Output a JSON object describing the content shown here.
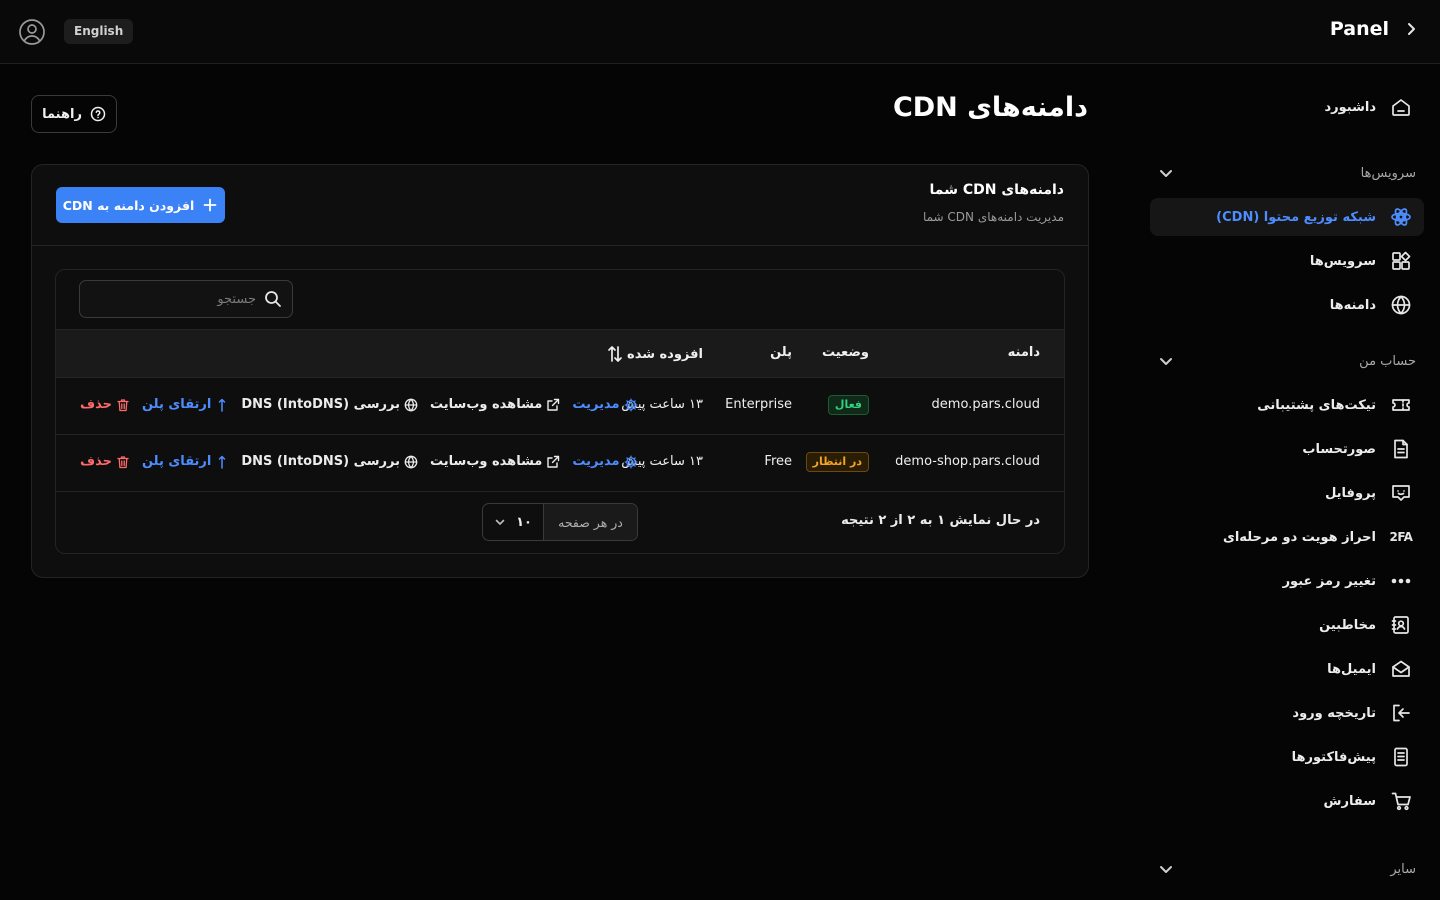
{
  "topbar": {
    "language": "English",
    "brand": "Panel"
  },
  "sidebar": {
    "dashboard": "داشبورد",
    "sections": [
      {
        "label": "سرویس‌ها",
        "items": [
          {
            "label": "شبکه توزیع محتوا (CDN)",
            "icon": "cdn-network-icon",
            "active": true
          },
          {
            "label": "سرویس‌ها",
            "icon": "services-icon"
          },
          {
            "label": "دامنه‌ها",
            "icon": "globe-icon"
          }
        ]
      },
      {
        "label": "حساب من",
        "items": [
          {
            "label": "تیکت‌های پشتیبانی",
            "icon": "ticket-icon"
          },
          {
            "label": "صورتحساب",
            "icon": "invoice-icon"
          },
          {
            "label": "پروفایل",
            "icon": "profile-icon"
          },
          {
            "label": "احراز هویت دو مرحله‌ای",
            "icon": "2fa-icon",
            "icon_text": "2FA"
          },
          {
            "label": "تغییر رمز عبور",
            "icon": "password-icon"
          },
          {
            "label": "مخاطبین",
            "icon": "contacts-icon"
          },
          {
            "label": "ایمیل‌ها",
            "icon": "mail-icon"
          },
          {
            "label": "تاریخچه ورود",
            "icon": "login-history-icon"
          },
          {
            "label": "پیش‌فاکتورها",
            "icon": "proforma-icon"
          },
          {
            "label": "سفارش",
            "icon": "cart-icon"
          }
        ]
      },
      {
        "label": "سایر",
        "items": []
      }
    ]
  },
  "page": {
    "title": "دامنه‌های CDN",
    "guide_button": "راهنما"
  },
  "card": {
    "title": "دامنه‌های CDN شما",
    "subtitle": "مدیریت دامنه‌های CDN شما",
    "add_button": "افزودن دامنه به CDN",
    "search_placeholder": "جستجو",
    "columns": {
      "domain": "دامنه",
      "status": "وضعیت",
      "plan": "پلن",
      "added": "افزوده شده"
    },
    "rows": [
      {
        "domain": "demo.pars.cloud",
        "status": "فعال",
        "status_type": "active",
        "plan": "Enterprise",
        "added": "۱۳ ساعت پیش"
      },
      {
        "domain": "demo-shop.pars.cloud",
        "status": "در انتظار",
        "status_type": "pending",
        "plan": "Free",
        "added": "۱۳ ساعت پیش"
      }
    ],
    "actions": {
      "manage": "مدیریت",
      "view": "مشاهده وب‌سایت",
      "dns": "بررسی DNS (IntoDNS)",
      "upgrade": "ارتقای پلن",
      "delete": "حذف"
    },
    "footer": {
      "summary": "در حال نمایش ۱ به ۲ از ۲ نتیجه",
      "per_page_label": "در هر صفحه",
      "per_page_value": "۱۰"
    }
  },
  "colors": {
    "accent": "#3b82f6",
    "link": "#4d8dff",
    "danger": "#ff6b6b",
    "success": "#35d07f",
    "warning": "#f5a524"
  }
}
